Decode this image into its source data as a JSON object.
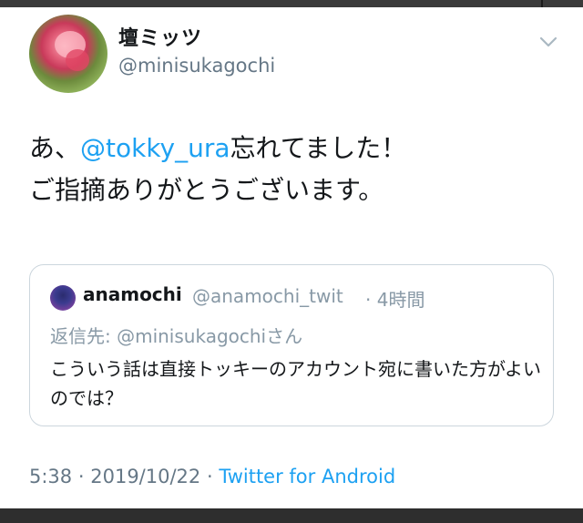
{
  "tweet": {
    "display_name": "壇ミッツ",
    "handle": "@minisukagochi",
    "text_prefix": "あ、",
    "mention": "@tokky_ura",
    "text_line1_suffix": "忘れてました！",
    "text_line2": "ご指摘ありがとうございます。",
    "time": "5:38",
    "date": "2019/10/22",
    "separator": "·",
    "source": "Twitter for Android",
    "menu_icon": "chevron-down-icon"
  },
  "quote": {
    "name": "anamochi",
    "handle": "@anamochi_twit",
    "age": "4時間",
    "reply_to": "返信先: @minisukagochiさん",
    "body": "こういう話は直接トッキーのアカウント宛に書いた方がよいのでは？"
  },
  "colors": {
    "link": "#1da1f2",
    "secondary_text": "#657786",
    "border": "#ccd6dd"
  }
}
